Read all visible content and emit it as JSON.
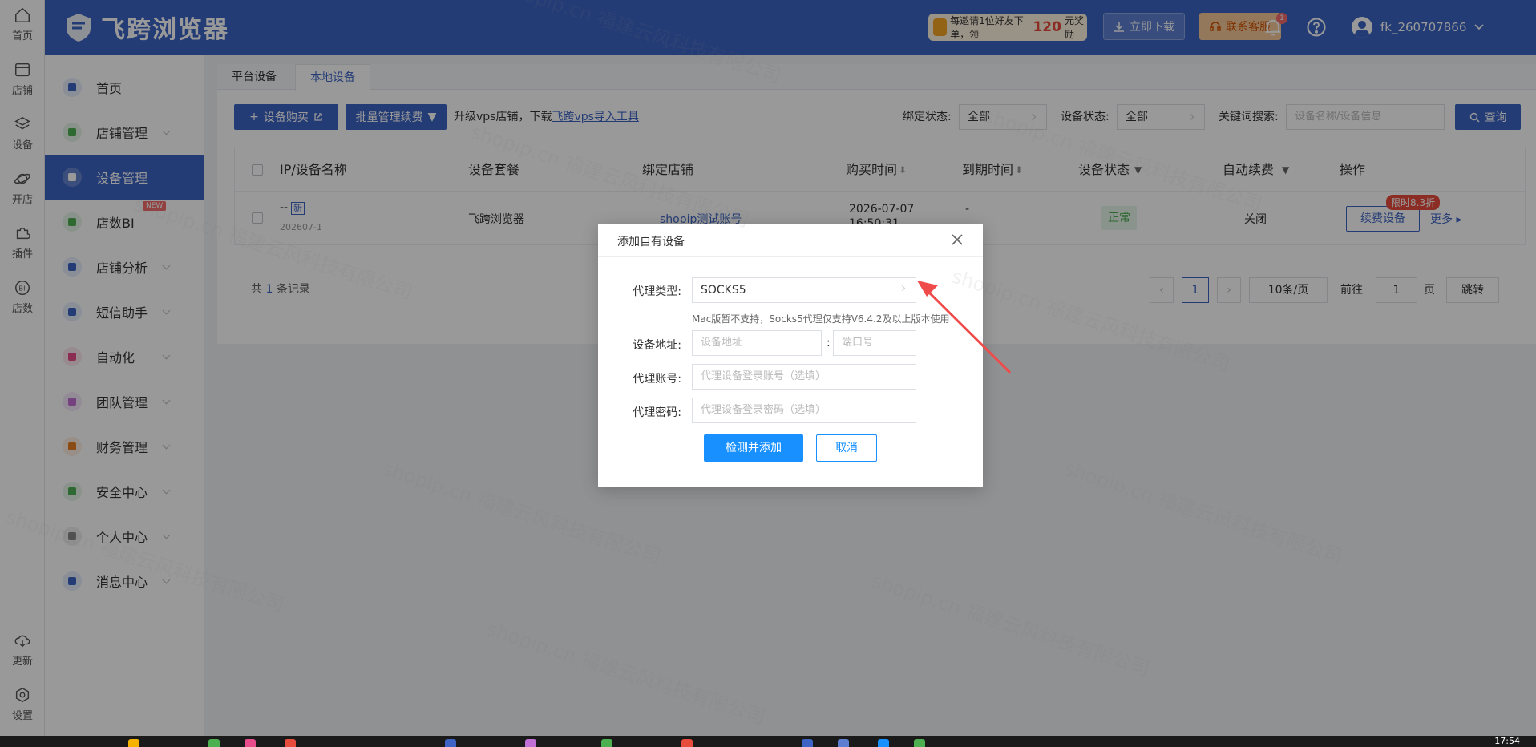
{
  "rail": {
    "items": [
      {
        "label": "首页",
        "icon": "home-icon"
      },
      {
        "label": "店铺",
        "icon": "store-icon"
      },
      {
        "label": "设备",
        "icon": "layers-icon"
      },
      {
        "label": "开店",
        "icon": "planet-icon"
      },
      {
        "label": "插件",
        "icon": "puzzle-icon"
      },
      {
        "label": "店数",
        "icon": "bi-icon"
      },
      {
        "label": "更新",
        "icon": "cloud-download-icon"
      },
      {
        "label": "设置",
        "icon": "settings-icon"
      }
    ]
  },
  "header": {
    "logo_text": "飞跨浏览器",
    "promo_pre": "每邀请1位好友下单，领",
    "promo_amount": "120",
    "promo_post": "元奖励",
    "download_label": "立即下载",
    "service_label": "联系客服",
    "notif_count": "1",
    "username": "fk_260707866"
  },
  "sidenav": {
    "items": [
      {
        "label": "首页",
        "color": "#3d64c4"
      },
      {
        "label": "店铺管理",
        "color": "#4caf50"
      },
      {
        "label": "设备管理",
        "color": "#3d64c4"
      },
      {
        "label": "店数BI",
        "color": "#4caf50",
        "badge": "NEW"
      },
      {
        "label": "店铺分析",
        "color": "#3d64c4"
      },
      {
        "label": "短信助手",
        "color": "#3d64c4"
      },
      {
        "label": "自动化",
        "color": "#e84c8b"
      },
      {
        "label": "团队管理",
        "color": "#c06fd4"
      },
      {
        "label": "财务管理",
        "color": "#e67e22"
      },
      {
        "label": "安全中心",
        "color": "#4caf50"
      },
      {
        "label": "个人中心",
        "color": "#888888"
      },
      {
        "label": "消息中心",
        "color": "#3d64c4"
      }
    ]
  },
  "tabs": [
    "平台设备",
    "本地设备"
  ],
  "toolbar": {
    "buy_label": "设备购买",
    "batch_label": "批量管理续费",
    "upgrade_text": "升级vps店铺，下载",
    "upgrade_link": "飞跨vps导入工具",
    "bind_label": "绑定状态:",
    "bind_value": "全部",
    "device_status_label": "设备状态:",
    "device_status_value": "全部",
    "keyword_label": "关键词搜索:",
    "keyword_placeholder": "设备名称/设备信息",
    "query_label": "查询"
  },
  "table": {
    "headers": [
      "IP/设备名称",
      "设备套餐",
      "绑定店铺",
      "购买时间",
      "到期时间",
      "设备状态",
      "自动续费",
      "操作"
    ],
    "row": {
      "name": "--",
      "new_tag": "新",
      "sub": "202607-1",
      "plan": "飞跨浏览器",
      "shop": "shopip测试账号",
      "buy_time": "2026-07-07",
      "buy_time_2": "16:50:31",
      "expire": "-",
      "status": "正常",
      "auto_renew": "关闭",
      "discount": "限时8.3折",
      "renew_label": "续费设备",
      "more_label": "更多"
    }
  },
  "pager": {
    "total_pre": "共",
    "total_num": "1",
    "total_post": "条记录",
    "page": "1",
    "size": "10条/页",
    "goto_pre": "前往",
    "goto_value": "1",
    "goto_post": "页",
    "jump": "跳转"
  },
  "modal": {
    "title": "添加自有设备",
    "type_label": "代理类型:",
    "type_value": "SOCKS5",
    "hint": "Mac版暂不支持，Socks5代理仅支持V6.4.2及以上版本使用",
    "addr_label": "设备地址:",
    "addr_placeholder": "设备地址",
    "port_placeholder": "端口号",
    "account_label": "代理账号:",
    "account_placeholder": "代理设备登录账号（选填）",
    "password_label": "代理密码:",
    "password_placeholder": "代理设备登录密码（选填）",
    "ok_label": "检测并添加",
    "cancel_label": "取消"
  },
  "watermark": "shopip.cn 福建云风科技有限公司",
  "taskbar": {
    "clock": "17:54"
  }
}
